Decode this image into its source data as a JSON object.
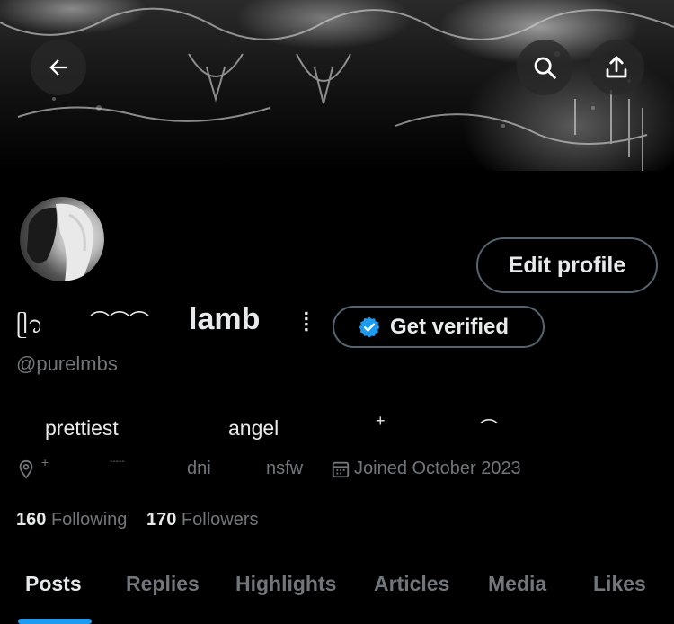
{
  "header": {
    "back_icon": "arrow-left-icon",
    "search_icon": "search-icon",
    "share_icon": "share-icon"
  },
  "profile": {
    "edit_label": "Edit profile",
    "name_prefix": "ᥫ᭡",
    "name_decor": "⌒⌒⌒",
    "name": "lamb",
    "name_suffix": "⡇",
    "verified_label": "Get verified",
    "handle": "@purelmbs"
  },
  "bio": {
    "items": [
      "prettiest",
      "angel",
      "+",
      "⌒"
    ]
  },
  "meta": {
    "location": "+",
    "dash": "-----",
    "dni": "dni",
    "nsfw": "nsfw",
    "joined": "Joined October 2023"
  },
  "stats": {
    "following_count": "160",
    "following_label": "Following",
    "followers_count": "170",
    "followers_label": "Followers"
  },
  "tabs": {
    "posts": "Posts",
    "replies": "Replies",
    "highlights": "Highlights",
    "articles": "Articles",
    "media": "Media",
    "likes": "Likes"
  },
  "colors": {
    "accent": "#1d9bf0",
    "muted": "#71767b",
    "border": "#536471"
  }
}
